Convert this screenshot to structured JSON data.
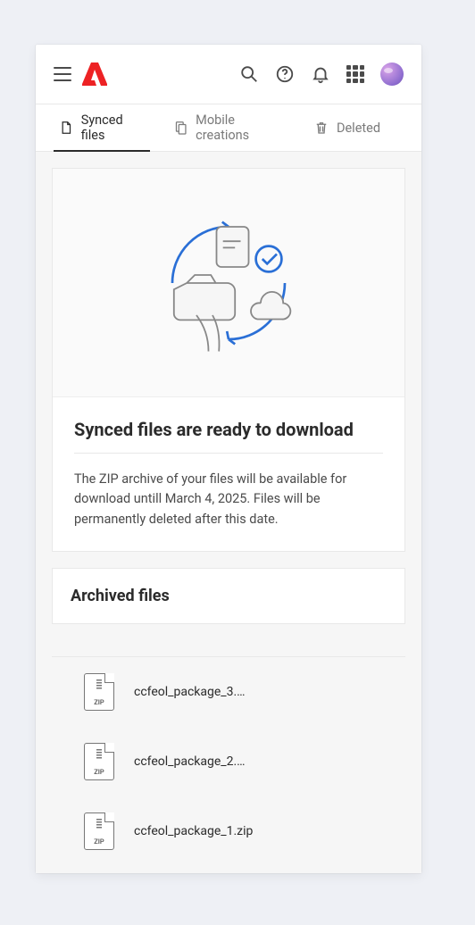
{
  "tabs": {
    "synced_files": "Synced files",
    "mobile_creations": "Mobile creations",
    "deleted": "Deleted"
  },
  "hero": {
    "title": "Synced files are ready to download",
    "body": "The ZIP archive of your files will be available for download untill March 4, 2025. Files will be permanently deleted after this date."
  },
  "archived": {
    "title": "Archived files",
    "files": [
      {
        "name": "ccfeol_package_3.…"
      },
      {
        "name": "ccfeol_package_2.…"
      },
      {
        "name": "ccfeol_package_1.zip"
      }
    ],
    "zip_label": "ZIP"
  }
}
